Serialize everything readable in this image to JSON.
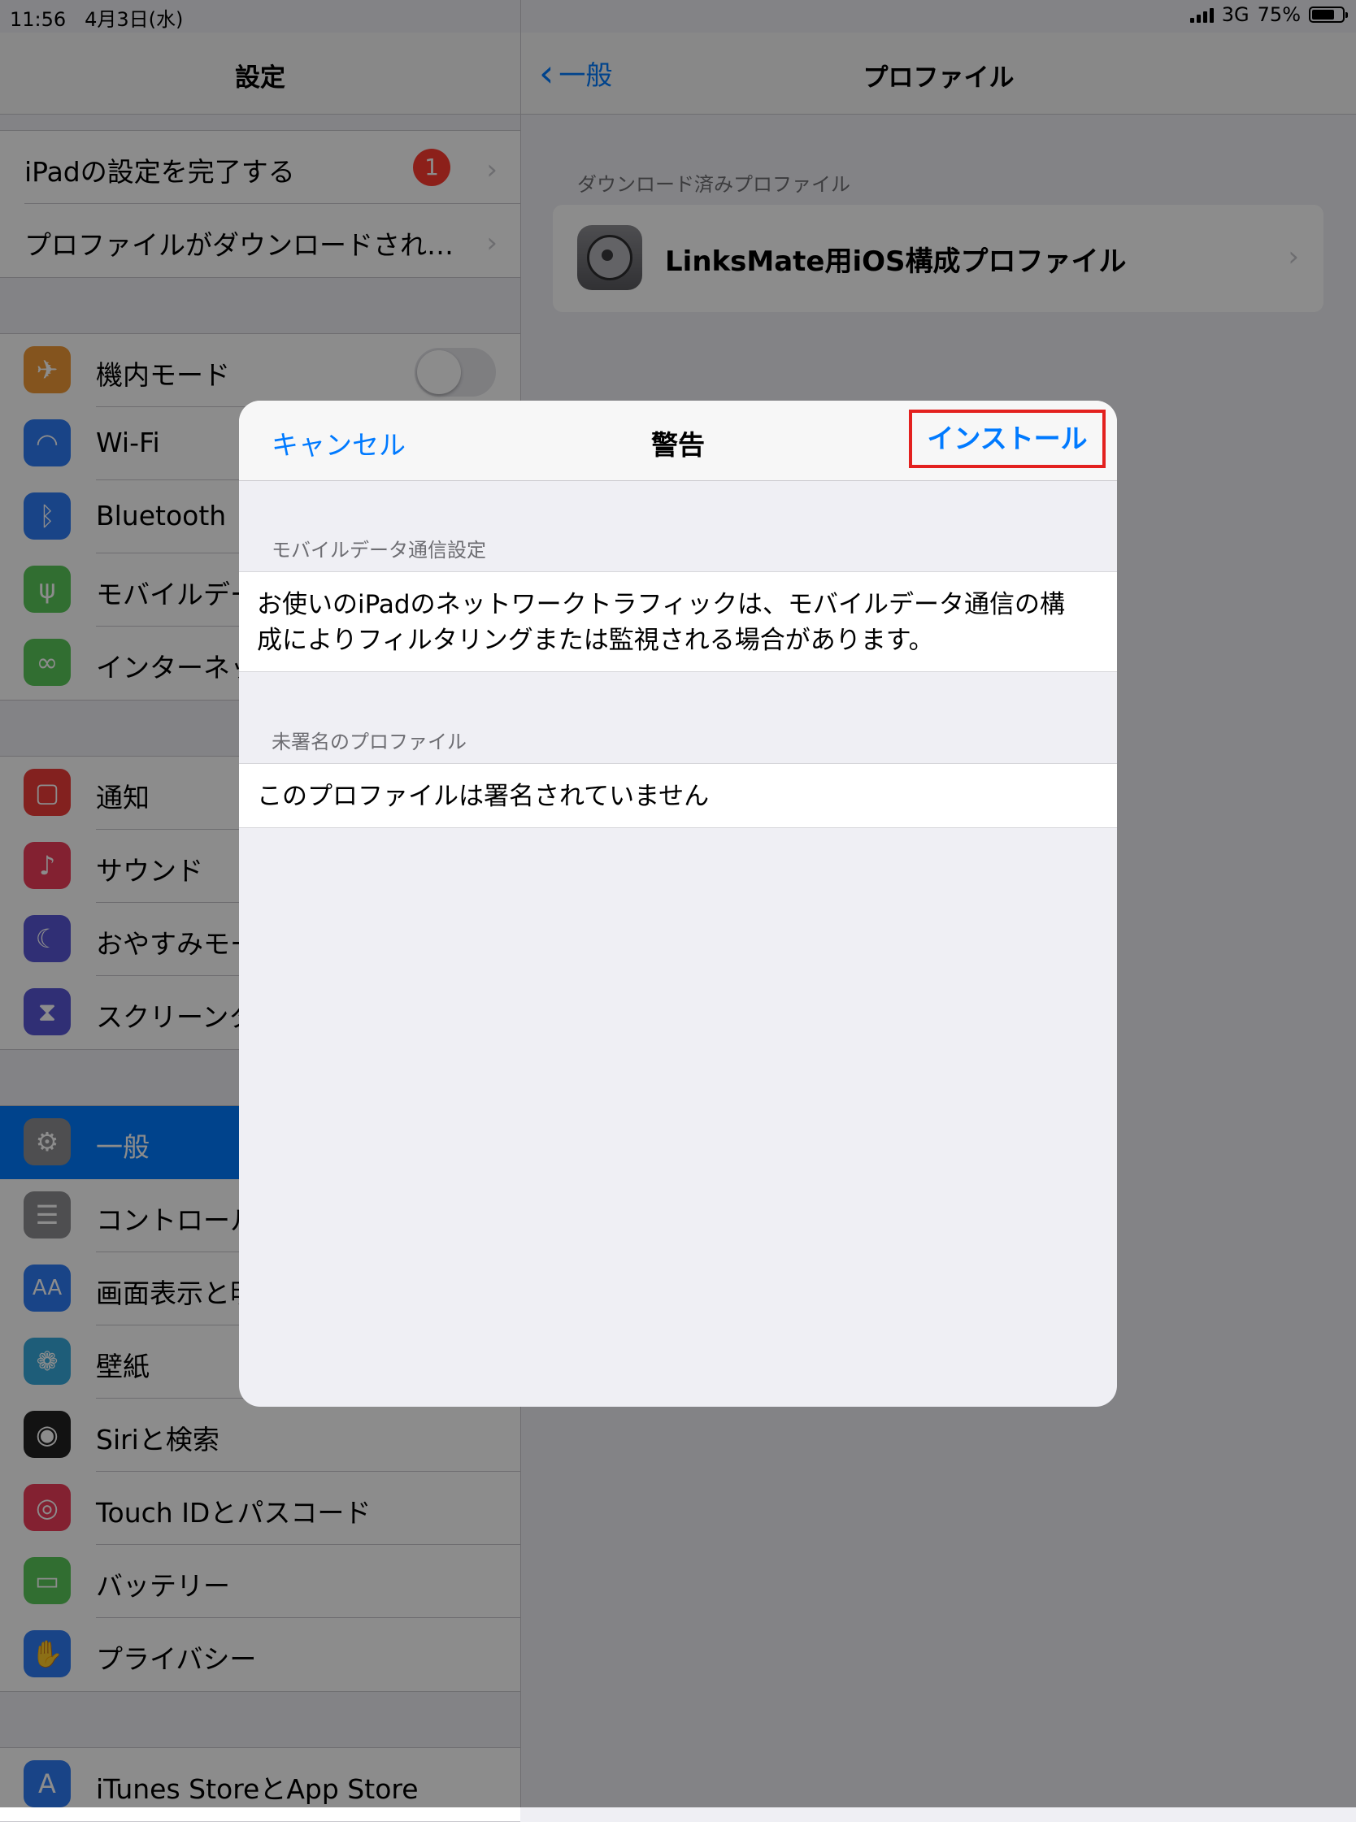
{
  "status_bar": {
    "time": "11:56",
    "date": "4月3日(水)",
    "network": "3G",
    "battery": "75%",
    "battery_level": 0.75
  },
  "sidebar": {
    "title": "設定",
    "top_items": [
      {
        "label": "iPadの設定を完了する",
        "badge": "1"
      },
      {
        "label": "プロファイルがダウンロードされ…"
      }
    ],
    "items": [
      {
        "label": "機内モード",
        "icon": "airplane-icon",
        "color": "#f19a37"
      },
      {
        "label": "Wi-Fi",
        "icon": "wifi-icon",
        "color": "#2f7cf6"
      },
      {
        "label": "Bluetooth",
        "icon": "bluetooth-icon",
        "color": "#2f7cf6"
      },
      {
        "label": "モバイルデー",
        "icon": "antenna-icon",
        "color": "#5ac85a"
      },
      {
        "label": "インターネッ",
        "icon": "link-icon",
        "color": "#5ac85a"
      },
      {
        "label": "通知",
        "icon": "notification-icon",
        "color": "#ef3d3a"
      },
      {
        "label": "サウンド",
        "icon": "speaker-icon",
        "color": "#ef3d5a"
      },
      {
        "label": "おやすみモー",
        "icon": "moon-icon",
        "color": "#5856d6"
      },
      {
        "label": "スクリーンタ",
        "icon": "hourglass-icon",
        "color": "#5856d6"
      },
      {
        "label": "一般",
        "icon": "gear-icon",
        "color": "#8e8e93"
      },
      {
        "label": "コントロール",
        "icon": "switches-icon",
        "color": "#8e8e93"
      },
      {
        "label": "画面表示と明",
        "icon": "text-size-icon",
        "color": "#2f7cf6"
      },
      {
        "label": "壁紙",
        "icon": "flower-icon",
        "color": "#37aadc"
      },
      {
        "label": "Siriと検索",
        "icon": "siri-icon",
        "color": "#222"
      },
      {
        "label": "Touch IDとパスコード",
        "icon": "fingerprint-icon",
        "color": "#ef3d5a"
      },
      {
        "label": "バッテリー",
        "icon": "battery-icon",
        "color": "#5ac85a"
      },
      {
        "label": "プライバシー",
        "icon": "hand-icon",
        "color": "#2f7cf6"
      },
      {
        "label": "iTunes StoreとApp Store",
        "icon": "app-store-icon",
        "color": "#2f7cf6"
      }
    ]
  },
  "detail": {
    "back_label": "一般",
    "title": "プロファイル",
    "section_header": "ダウンロード済みプロファイル",
    "profile_name": "LinksMate用iOS構成プロファイル"
  },
  "modal": {
    "cancel_label": "キャンセル",
    "title": "警告",
    "install_label": "インストール",
    "sections": [
      {
        "header": "モバイルデータ通信設定",
        "text": "お使いのiPadのネットワークトラフィックは、モバイルデータ通信の構成によりフィルタリングまたは監視される場合があります。"
      },
      {
        "header": "未署名のプロファイル",
        "text": "このプロファイルは署名されていません"
      }
    ]
  }
}
